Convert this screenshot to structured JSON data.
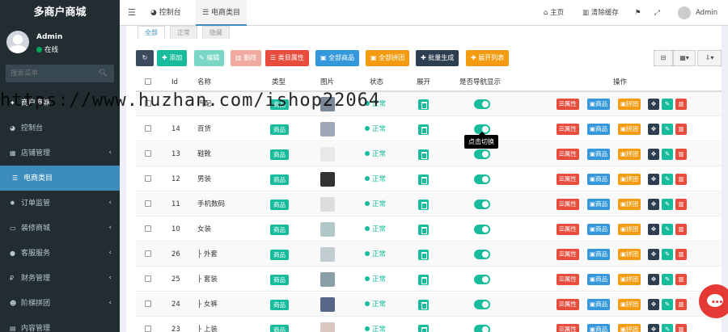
{
  "sidebar": {
    "logo": "多商户商城",
    "user_name": "Admin",
    "user_status": "在线",
    "search_placeholder": "搜索菜单",
    "items": [
      {
        "label": "商户商城",
        "icon": "dashboard-icon"
      },
      {
        "label": "控制台",
        "icon": "dashboard-icon"
      },
      {
        "label": "店铺管理",
        "icon": "store-icon"
      },
      {
        "label": "电商类目",
        "icon": "list-icon"
      },
      {
        "label": "订单监管",
        "icon": "gear-icon"
      },
      {
        "label": "装修商城",
        "icon": "desktop-icon"
      },
      {
        "label": "客服服务",
        "icon": "chat-icon"
      },
      {
        "label": "财务管理",
        "icon": "money-icon"
      },
      {
        "label": "阶梯拼团",
        "icon": "users-icon"
      },
      {
        "label": "内容管理",
        "icon": "file-icon"
      }
    ]
  },
  "topbar": {
    "tab_dashboard": "控制台",
    "tab_category": "电商类目",
    "home": "主页",
    "clear_cache": "清除缓存",
    "user": "Admin"
  },
  "subtabs": [
    "全部",
    "正常",
    "隐藏"
  ],
  "toolbar": {
    "add": "添加",
    "edit": "编辑",
    "delete": "删除",
    "category_attr": "类目属性",
    "all_goods": "全部商品",
    "all_groupbuy": "全部拼团",
    "batch_generate": "批量生成",
    "expand_list": "展开列表"
  },
  "table": {
    "headers": [
      "Id",
      "名称",
      "类型",
      "图片",
      "状态",
      "展开",
      "是否导航显示",
      "操作"
    ],
    "rows": [
      {
        "id": "",
        "name": "汽配",
        "type": "商品",
        "status": "正常"
      },
      {
        "id": "14",
        "name": "百货",
        "type": "商品",
        "status": "正常"
      },
      {
        "id": "13",
        "name": "鞋靴",
        "type": "商品",
        "status": "正常"
      },
      {
        "id": "12",
        "name": "男装",
        "type": "商品",
        "status": "正常"
      },
      {
        "id": "11",
        "name": "手机数码",
        "type": "商品",
        "status": "正常"
      },
      {
        "id": "10",
        "name": "女装",
        "type": "商品",
        "status": "正常"
      },
      {
        "id": "26",
        "name": "├ 外套",
        "type": "商品",
        "status": "正常"
      },
      {
        "id": "25",
        "name": "├ 套装",
        "type": "商品",
        "status": "正常"
      },
      {
        "id": "24",
        "name": "├ 女裤",
        "type": "商品",
        "status": "正常"
      },
      {
        "id": "23",
        "name": "├ 上装",
        "type": "商品",
        "status": "正常"
      }
    ],
    "op_labels": {
      "attr": "属性",
      "goods": "商品",
      "group": "拼团"
    }
  },
  "tooltip": "点击切换",
  "watermark": "https://www.huzhan.com/ishop22064",
  "colors": {
    "sidebar_bg": "#222d32",
    "accent": "#3c8dbc",
    "success": "#18bc9c",
    "danger": "#e74c3c",
    "primary": "#3498db",
    "warning": "#f39c12"
  }
}
